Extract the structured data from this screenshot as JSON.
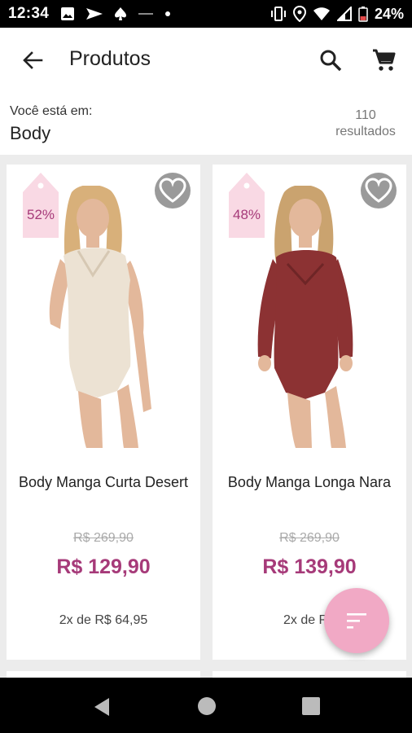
{
  "status_bar": {
    "time": "12:34",
    "battery_percent": "24%",
    "icons_left": [
      "image-icon",
      "send-icon",
      "spade-icon",
      "minus-icon",
      "dot-icon"
    ],
    "icons_right": [
      "vibrate-icon",
      "location-icon",
      "wifi-icon",
      "signal-icon",
      "battery-icon"
    ]
  },
  "app_bar": {
    "title": "Produtos",
    "back_icon": "arrow-back-icon",
    "search_icon": "search-icon",
    "cart_icon": "cart-icon"
  },
  "info": {
    "location_label": "Você está em:",
    "location_value": "Body",
    "results_count": "110",
    "results_label": "resultados"
  },
  "products": [
    {
      "discount": "52%",
      "name": "Body Manga Curta Desert",
      "old_price": "R$ 269,90",
      "new_price": "R$ 129,90",
      "installment": "2x de R$ 64,95",
      "garment_color": "#ece2d3"
    },
    {
      "discount": "48%",
      "name": "Body Manga Longa Nara",
      "old_price": "R$ 269,90",
      "new_price": "R$ 139,90",
      "installment": "2x de R$",
      "garment_color": "#8c3233"
    }
  ],
  "colors": {
    "accent": "#a63a79",
    "tag_bg": "#f9d9e4",
    "fab_bg": "#f1a9c5",
    "fav_bg": "#9a9a9a"
  },
  "fab_icon": "sort-icon"
}
